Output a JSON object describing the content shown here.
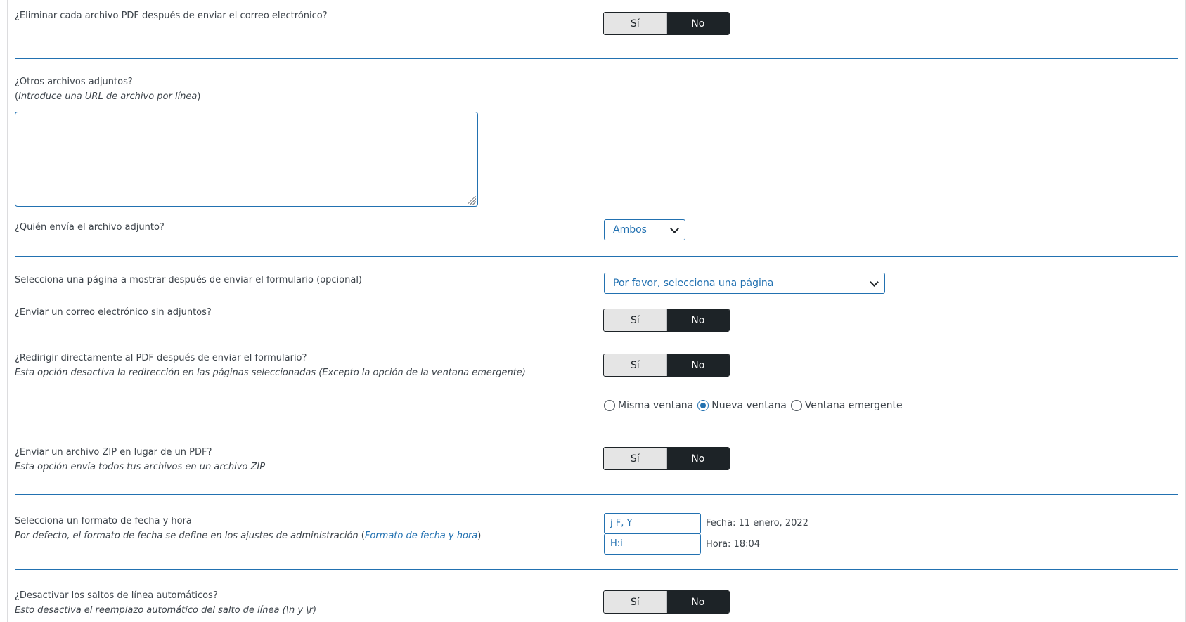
{
  "delete_pdf": {
    "label": "¿Eliminar cada archivo PDF después de enviar el correo electrónico?",
    "yes": "Sí",
    "no": "No",
    "selected": "No"
  },
  "other_attachments": {
    "label": "¿Otros archivos adjuntos?",
    "hint_prefix": "(",
    "hint": "Introduce una URL de archivo por línea",
    "hint_suffix": ")",
    "value": ""
  },
  "sender": {
    "label": "¿Quién envía el archivo adjunto?",
    "selected": "Ambos"
  },
  "redirect_page": {
    "label": "Selecciona una página a mostrar después de enviar el formulario (opcional)",
    "selected": "Por favor, selecciona una página"
  },
  "no_attachments": {
    "label": "¿Enviar un correo electrónico sin adjuntos?",
    "yes": "Sí",
    "no": "No",
    "selected": "No"
  },
  "redirect_pdf": {
    "label": "¿Redirigir directamente al PDF después de enviar el formulario?",
    "hint": "Esta opción desactiva la redirección en las páginas seleccionadas (Excepto la opción de la ventana emergente)",
    "yes": "Sí",
    "no": "No",
    "selected": "No",
    "window_options": [
      "Misma ventana",
      "Nueva ventana",
      "Ventana emergente"
    ],
    "window_selected": "Nueva ventana"
  },
  "zip": {
    "label": "¿Enviar un archivo ZIP en lugar de un PDF?",
    "hint": "Esta opción envía todos tus archivos en un archivo ZIP",
    "yes": "Sí",
    "no": "No",
    "selected": "No"
  },
  "datetime": {
    "label": "Selecciona un formato de fecha y hora",
    "hint": "Por defecto, el formato de fecha se define en los ajustes de administración",
    "hint_link": "Formato de fecha y hora",
    "date_format": "j F, Y",
    "date_preview": "Fecha: 11 enero, 2022",
    "time_format": "H:i",
    "time_preview": "Hora: 18:04"
  },
  "line_breaks": {
    "label": "¿Desactivar los saltos de línea automáticos?",
    "hint": "Esto desactiva el reemplazo automático del salto de línea (\\n y \\r)",
    "yes": "Sí",
    "no": "No",
    "selected": "No"
  },
  "colors": {
    "accent": "#2271b1",
    "toggle_active": "#1d2327",
    "toggle_inactive": "#e5e5e5",
    "text": "#3c434a"
  }
}
